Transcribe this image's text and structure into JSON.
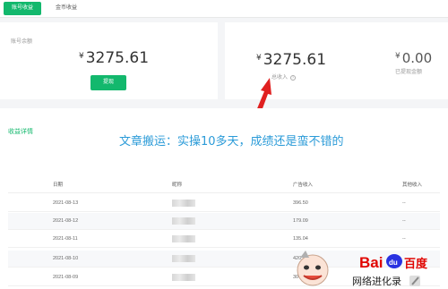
{
  "tabs": [
    {
      "label": "账号收益",
      "active": true
    },
    {
      "label": "金币收益",
      "active": false
    }
  ],
  "balance": {
    "label": "账号余额",
    "currency": "¥",
    "amount": "3275.61",
    "withdraw_label": "提现"
  },
  "total": {
    "currency": "¥",
    "amount": "3275.61",
    "label": "总收入",
    "info_glyph": "?"
  },
  "withdrawn": {
    "currency": "¥",
    "amount": "0.00",
    "label": "已提现金额"
  },
  "details": {
    "title": "收益详情",
    "columns": [
      "日期",
      "昵称",
      "广告收入",
      "其他收入"
    ],
    "rows": [
      {
        "date": "2021-08-13",
        "ad": "396.50",
        "other": "--"
      },
      {
        "date": "2021-08-12",
        "ad": "179.09",
        "other": "--"
      },
      {
        "date": "2021-08-11",
        "ad": "135.04",
        "other": "--"
      },
      {
        "date": "2021-08-10",
        "ad": "420.",
        "other": ""
      },
      {
        "date": "2021-08-09",
        "ad": "304.",
        "other": ""
      }
    ]
  },
  "overlay_caption": "文章搬运：实操10多天，成绩还是蛮不错的",
  "watermark": {
    "brand_a": "Bai",
    "brand_b": "百度",
    "paw": "du",
    "sub": "网络进化录"
  },
  "colors": {
    "accent": "#13b86d",
    "caption": "#2b9bd8",
    "arrow": "#e02020"
  }
}
